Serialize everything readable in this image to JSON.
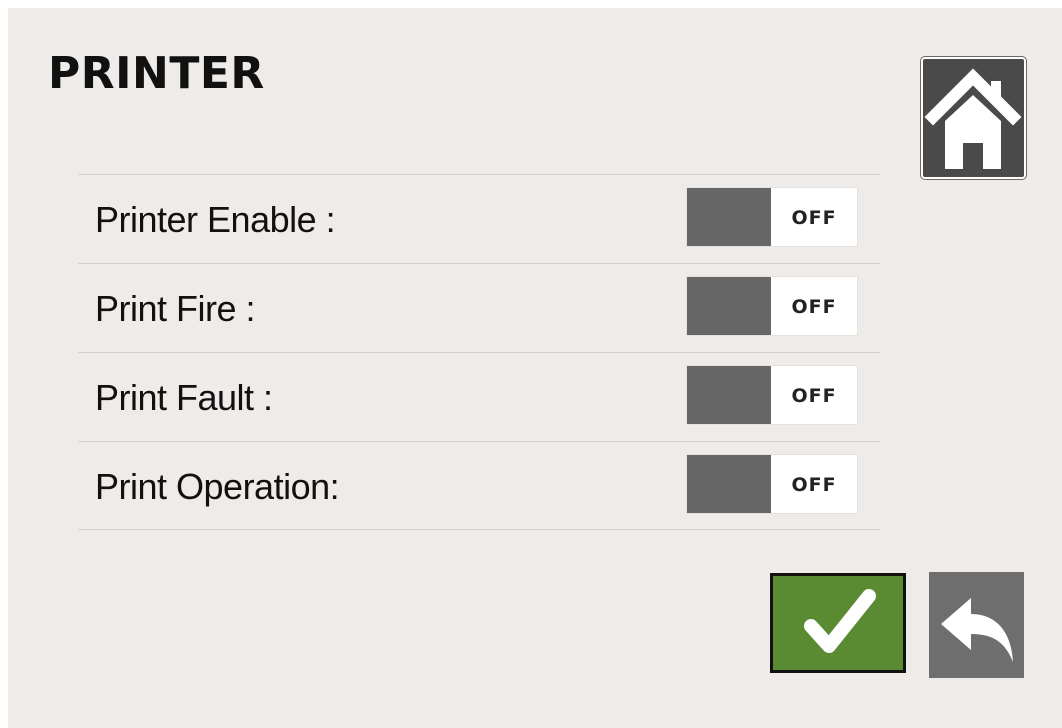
{
  "page": {
    "title": "PRINTER"
  },
  "header": {
    "home_icon": "home-icon"
  },
  "settings": [
    {
      "label": "Printer Enable :",
      "state": "OFF"
    },
    {
      "label": "Print Fire :",
      "state": "OFF"
    },
    {
      "label": "Print Fault :",
      "state": "OFF"
    },
    {
      "label": "Print Operation:",
      "state": "OFF"
    }
  ],
  "footer": {
    "confirm_icon": "checkmark-icon",
    "back_icon": "back-arrow-icon"
  },
  "colors": {
    "background": "#eeebe8",
    "toggle_knob": "#666666",
    "confirm_button": "#5a8a31",
    "back_button": "#6e6e6e",
    "home_button": "#4a4a4a"
  }
}
